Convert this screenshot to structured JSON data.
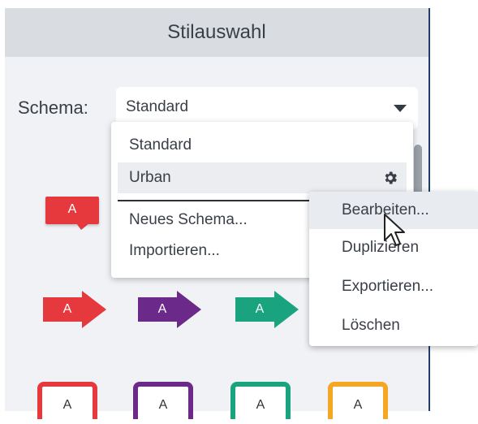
{
  "panel": {
    "title": "Stilauswahl"
  },
  "schema": {
    "label": "Schema:",
    "selected": "Standard"
  },
  "dropdown": {
    "items": [
      "Standard",
      "Urban"
    ],
    "actions": [
      "Neues Schema...",
      "Importieren..."
    ]
  },
  "context_menu": {
    "items": [
      "Bearbeiten...",
      "Duplizieren",
      "Exportieren...",
      "Löschen"
    ]
  },
  "styles": {
    "callout_label": "A",
    "arrow_label": "A",
    "box_label": "A",
    "colors": {
      "red": "#e5393d",
      "purple": "#6b2a8a",
      "teal": "#1aa37f",
      "orange": "#f5a623"
    }
  }
}
